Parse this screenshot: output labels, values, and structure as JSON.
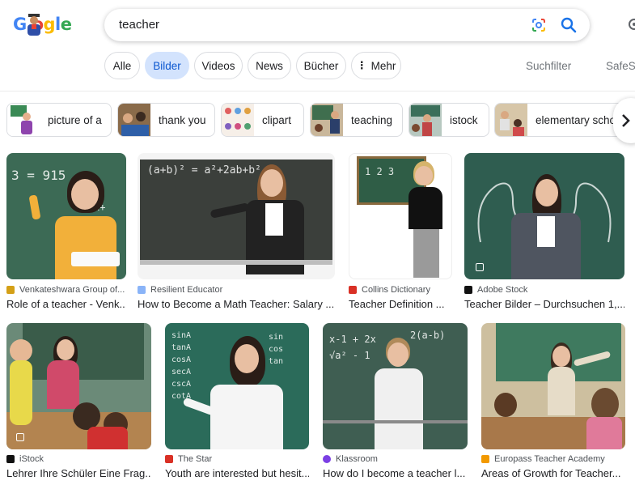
{
  "search": {
    "query": "teacher"
  },
  "logo": {
    "text": "Google"
  },
  "tabs": [
    {
      "label": "Alle",
      "active": false
    },
    {
      "label": "Bilder",
      "active": true
    },
    {
      "label": "Videos",
      "active": false
    },
    {
      "label": "News",
      "active": false
    },
    {
      "label": "Bücher",
      "active": false
    },
    {
      "label": "Mehr",
      "active": false
    }
  ],
  "tools": {
    "filter": "Suchfilter",
    "safesearch": "SafeSe"
  },
  "chips": [
    {
      "label": "picture of a"
    },
    {
      "label": "thank you"
    },
    {
      "label": "clipart"
    },
    {
      "label": "teaching"
    },
    {
      "label": "istock"
    },
    {
      "label": "elementary scho"
    }
  ],
  "results": [
    {
      "source": "Venkateshwara Group of...",
      "title": "Role of a teacher - Venk..."
    },
    {
      "source": "Resilient Educator",
      "title": "How to Become a Math Teacher: Salary ..."
    },
    {
      "source": "Collins Dictionary",
      "title": "Teacher Definition ..."
    },
    {
      "source": "Adobe Stock",
      "title": "Teacher Bilder – Durchsuchen 1,..."
    },
    {
      "source": "iStock",
      "title": "Lehrer Ihre Schüler Eine Frag..."
    },
    {
      "source": "The Star",
      "title": "Youth are interested but hesit..."
    },
    {
      "source": "Klassroom",
      "title": "How do I become a teacher l..."
    },
    {
      "source": "Europass Teacher Academy",
      "title": "Areas of Growth for Teacher..."
    }
  ],
  "colors": {
    "accent": "#1a73e8",
    "active_tab_bg": "#d3e3fd",
    "active_tab_text": "#0b57d0"
  }
}
